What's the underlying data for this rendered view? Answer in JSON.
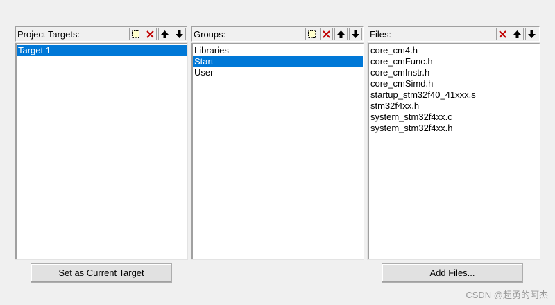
{
  "targets": {
    "title": "Project Targets:",
    "items": [
      "Target 1"
    ],
    "selected": 0,
    "toolbar": [
      "new-icon",
      "delete-icon",
      "move-up-icon",
      "move-down-icon"
    ]
  },
  "groups": {
    "title": "Groups:",
    "items": [
      "Libraries",
      "Start",
      "User"
    ],
    "selected": 1,
    "toolbar": [
      "new-icon",
      "delete-icon",
      "move-up-icon",
      "move-down-icon"
    ]
  },
  "files": {
    "title": "Files:",
    "items": [
      "core_cm4.h",
      "core_cmFunc.h",
      "core_cmInstr.h",
      "core_cmSimd.h",
      "startup_stm32f40_41xxx.s",
      "stm32f4xx.h",
      "system_stm32f4xx.c",
      "system_stm32f4xx.h"
    ],
    "toolbar": [
      "delete-icon",
      "move-up-icon",
      "move-down-icon"
    ]
  },
  "buttons": {
    "set_current": "Set as Current Target",
    "add_files": "Add Files..."
  },
  "watermark": "CSDN @超勇的阿杰",
  "colors": {
    "selection": "#0078d7",
    "delete_icon": "#c00000"
  }
}
